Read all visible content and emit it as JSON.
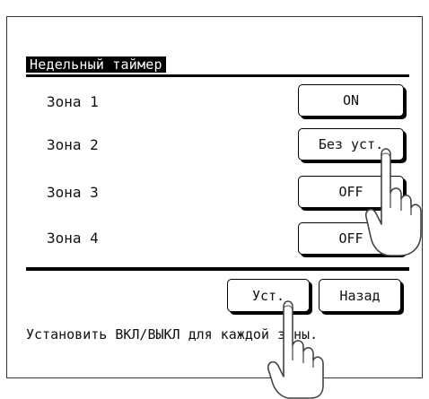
{
  "screen": {
    "title": "Недельный таймер",
    "zones": [
      {
        "label": "Зона 1",
        "value": "ON"
      },
      {
        "label": "Зона 2",
        "value": "Без уст."
      },
      {
        "label": "Зона 3",
        "value": "OFF"
      },
      {
        "label": "Зона 4",
        "value": "OFF"
      }
    ],
    "set_button": "Уст.",
    "back_button": "Назад",
    "status_text": "Установить ВКЛ/ВЫКЛ для каждой зоны."
  }
}
